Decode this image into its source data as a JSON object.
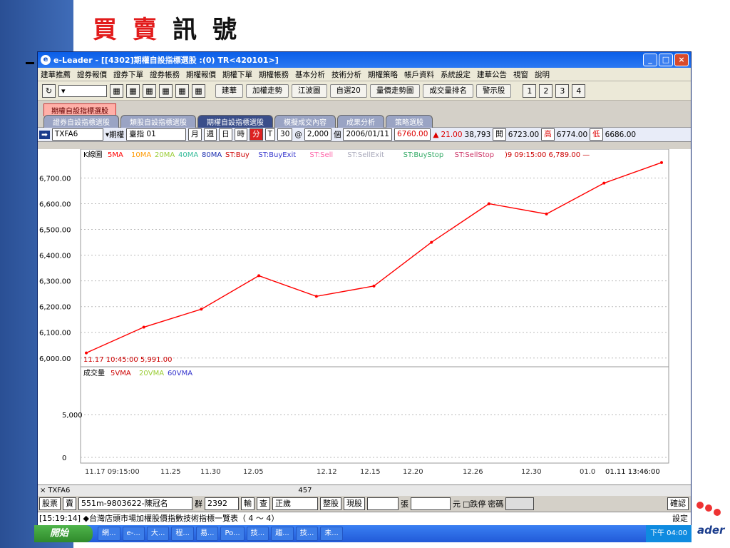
{
  "slide_title": {
    "c1": "買",
    "c2": "賣",
    "c3": "訊",
    "c4": "號"
  },
  "window": {
    "title": "e-Leader - [[4302]期權自設指標選股 :(0) TR<420101>]"
  },
  "menu": [
    "建華推薦",
    "證券報價",
    "證券下單",
    "證券帳務",
    "期權報價",
    "期權下單",
    "期權帳務",
    "基本分析",
    "技術分析",
    "期權策略",
    "帳戶資料",
    "系統設定",
    "建華公告",
    "視窗",
    "說明"
  ],
  "toolbar": {
    "b1": "建華",
    "b2": "加權走勢",
    "b3": "江波圖",
    "b4": "自選20",
    "b5": "量價走勢圖",
    "b6": "成交量排名",
    "b7": "警示股",
    "n1": "1",
    "n2": "2",
    "n3": "3",
    "n4": "4"
  },
  "tabs": {
    "top": "期權自設指標選股",
    "row": [
      "證券自設指標選股",
      "類股自設指標選股",
      "期權自設指標選股",
      "模擬成交內容",
      "成果分析",
      "策略選股"
    ]
  },
  "quote": {
    "symbol": "TXFA6",
    "type": "期權",
    "name": "臺指 01",
    "p1": "月",
    "p2": "週",
    "p3": "日",
    "p4": "時",
    "p5": "分",
    "p6": "T",
    "n": "30",
    "at": "@",
    "count": "2,000",
    "unit": "個",
    "date": "2006/01/11",
    "price": "6760.00",
    "up": "▲",
    "change": "21.00",
    "volume": "38,793",
    "open_l": "開",
    "open": "6723.00",
    "high_l": "高",
    "high": "6774.00",
    "low_l": "低",
    "low": "6686.00"
  },
  "price_panel": {
    "label": "K線圖",
    "ma": [
      "5MA",
      "10MA",
      "20MA",
      "40MA",
      "80MA"
    ],
    "st": [
      "ST:Buy",
      "ST:BuyExit",
      "ST:Sell",
      "ST:SellExit",
      "ST:BuyStop",
      "ST:SellStop"
    ],
    "last_info": ")9 09:15:00  6,789.00 —",
    "low_info": "11.17 10:45:00  5,991.00",
    "yticks": [
      "6,700.00",
      "6,600.00",
      "6,500.00",
      "6,400.00",
      "6,300.00",
      "6,200.00",
      "6,100.00",
      "6,000.00"
    ]
  },
  "volume_panel": {
    "label": "成交量",
    "ma": [
      "5VMA",
      "20VMA",
      "60VMA"
    ],
    "yticks": [
      "5,000",
      "0"
    ]
  },
  "xaxis": [
    "11.17 09:15:00",
    "11.25",
    "11.30",
    "12.05",
    "12.12",
    "12.15",
    "12.20",
    "12.26",
    "12.30",
    "01.0",
    "01.11 13:46:00"
  ],
  "stockbar": {
    "sym": "TXFA6",
    "num": "457"
  },
  "order": {
    "f1": "股票",
    "f2": "賣",
    "acct": "551m-9803622-陳冠名",
    "grp": "群",
    "code": "2392",
    "ac": "輸",
    "q": "查",
    "status": "正歲",
    "t1": "整股",
    "t2": "現股",
    "u1": "張",
    "u2": "元",
    "chk": "跌停",
    "pw": "密碼",
    "ok": "確認"
  },
  "news": {
    "text": "[15:19:14]  ◆台灣店頭市場加權股價指數技術指標一覽表（ 4 ～ 4）",
    "right": "設定"
  },
  "taskbar": {
    "start": "開始",
    "items": [
      "網...",
      "e-...",
      "大...",
      "程...",
      "易...",
      "Po...",
      "技...",
      "趨...",
      "技...",
      "未..."
    ],
    "time": "下午 04:00"
  },
  "colors": {
    "ma5": "#ff0000",
    "ma10": "#ff9900",
    "ma20": "#99cc33",
    "ma40": "#33bb99",
    "ma80": "#1c2fb0",
    "buy": "#0000ee",
    "sell": "#dd0000"
  },
  "chart_data": {
    "type": "candlestick",
    "xlabel": "",
    "ylabel": "",
    "ylim": [
      5980,
      6790
    ],
    "x": [
      "11.17",
      "11.25",
      "11.30",
      "12.05",
      "12.12",
      "12.15",
      "12.20",
      "12.26",
      "12.30",
      "01.05",
      "01.11"
    ],
    "price": [
      6020,
      6120,
      6190,
      6320,
      6240,
      6280,
      6450,
      6600,
      6560,
      6680,
      6760
    ]
  }
}
